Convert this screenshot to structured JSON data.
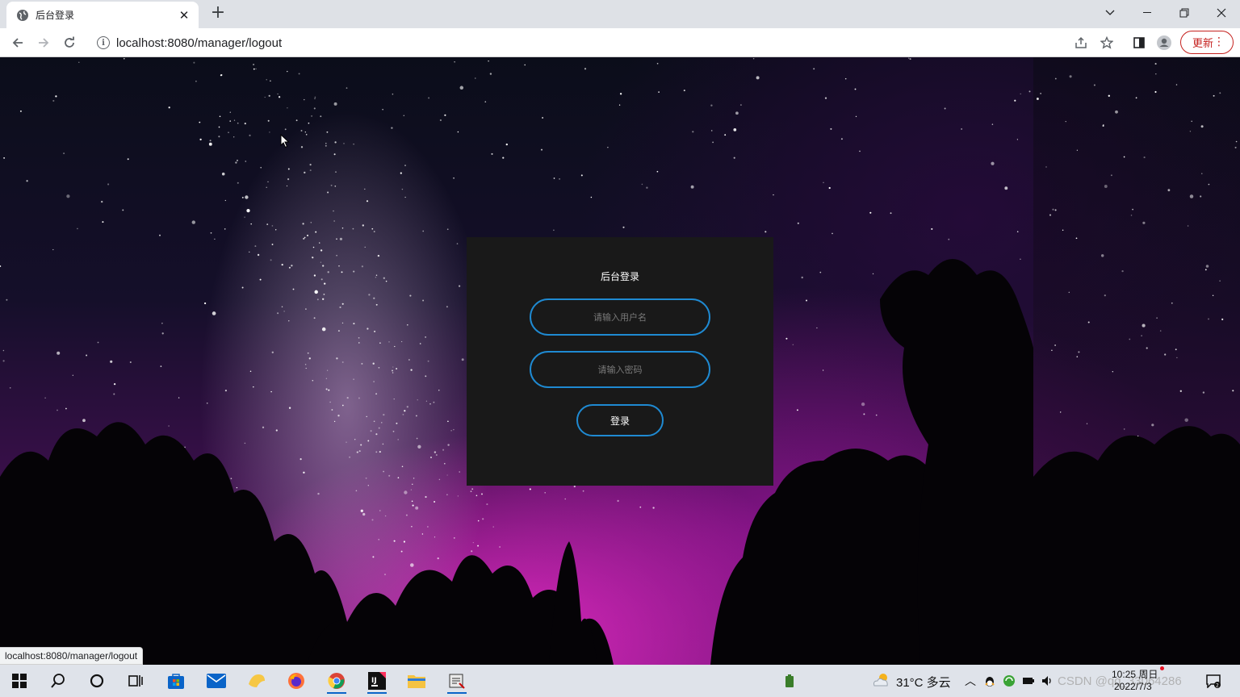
{
  "browser": {
    "tab": {
      "title": "后台登录"
    },
    "url": "localhost:8080/manager/logout",
    "update_label": "更新"
  },
  "login": {
    "title": "后台登录",
    "username_placeholder": "请输入用户名",
    "password_placeholder": "请输入密码",
    "submit_label": "登录"
  },
  "status_bar": {
    "link": "localhost:8080/manager/logout"
  },
  "taskbar": {
    "weather": "31°C 多云",
    "time": "10:25 周日",
    "date": "2022/7/3",
    "watermark": "CSDN @qq_33064286"
  },
  "colors": {
    "accent": "#1f8ad2",
    "card_bg": "#191919",
    "update_red": "#c5221f"
  }
}
